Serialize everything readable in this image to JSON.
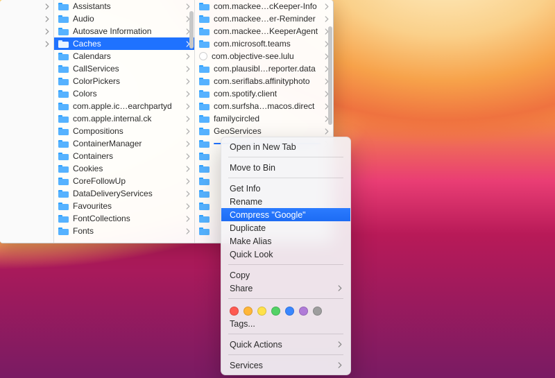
{
  "finder": {
    "col0": {
      "rows": 4
    },
    "col1": {
      "items": [
        {
          "label": "Assistants"
        },
        {
          "label": "Audio"
        },
        {
          "label": "Autosave Information"
        },
        {
          "label": "Caches",
          "selected": true
        },
        {
          "label": "Calendars"
        },
        {
          "label": "CallServices"
        },
        {
          "label": "ColorPickers"
        },
        {
          "label": "Colors"
        },
        {
          "label": "com.apple.ic…earchpartyd"
        },
        {
          "label": "com.apple.internal.ck"
        },
        {
          "label": "Compositions"
        },
        {
          "label": "ContainerManager"
        },
        {
          "label": "Containers"
        },
        {
          "label": "Cookies"
        },
        {
          "label": "CoreFollowUp"
        },
        {
          "label": "DataDeliveryServices"
        },
        {
          "label": "Favourites"
        },
        {
          "label": "FontCollections"
        },
        {
          "label": "Fonts"
        }
      ],
      "scrollbar": {
        "thumbTop": 14,
        "thumbHeight": 54
      }
    },
    "col2": {
      "items": [
        {
          "label": "com.mackee…cKeeper-Info"
        },
        {
          "label": "com.mackee…er-Reminder"
        },
        {
          "label": "com.mackee…KeeperAgent"
        },
        {
          "label": "com.microsoft.teams"
        },
        {
          "label": "com.objective-see.lulu",
          "icon": "circle"
        },
        {
          "label": "com.plausibl…reporter.data"
        },
        {
          "label": "com.seriflabs.affinityphoto"
        },
        {
          "label": "com.spotify.client"
        },
        {
          "label": "com.surfsha…macos.direct"
        },
        {
          "label": "familycircled"
        },
        {
          "label": "GeoServices"
        },
        {
          "label": "",
          "rcselected": true
        },
        {
          "label": ""
        },
        {
          "label": ""
        },
        {
          "label": ""
        },
        {
          "label": ""
        },
        {
          "label": ""
        },
        {
          "label": ""
        },
        {
          "label": ""
        }
      ],
      "scrollbar": {
        "thumbTop": 36,
        "thumbHeight": 142
      }
    }
  },
  "context_menu": {
    "groups": [
      {
        "items": [
          {
            "label": "Open in New Tab"
          }
        ]
      },
      {
        "items": [
          {
            "label": "Move to Bin"
          }
        ]
      },
      {
        "items": [
          {
            "label": "Get Info"
          },
          {
            "label": "Rename"
          },
          {
            "label": "Compress \"Google\"",
            "selected": true
          },
          {
            "label": "Duplicate"
          },
          {
            "label": "Make Alias"
          },
          {
            "label": "Quick Look"
          }
        ]
      },
      {
        "items": [
          {
            "label": "Copy"
          },
          {
            "label": "Share",
            "submenu": true
          }
        ]
      },
      {
        "tags": true,
        "items": [
          {
            "label": "Tags..."
          }
        ]
      },
      {
        "items": [
          {
            "label": "Quick Actions",
            "submenu": true
          }
        ]
      },
      {
        "items": [
          {
            "label": "Services",
            "submenu": true
          }
        ]
      }
    ],
    "tag_colors": [
      "#ff5a52",
      "#ffb639",
      "#ffe14a",
      "#53d266",
      "#3a87ff",
      "#b07bd8",
      "#9e9e9e"
    ]
  }
}
